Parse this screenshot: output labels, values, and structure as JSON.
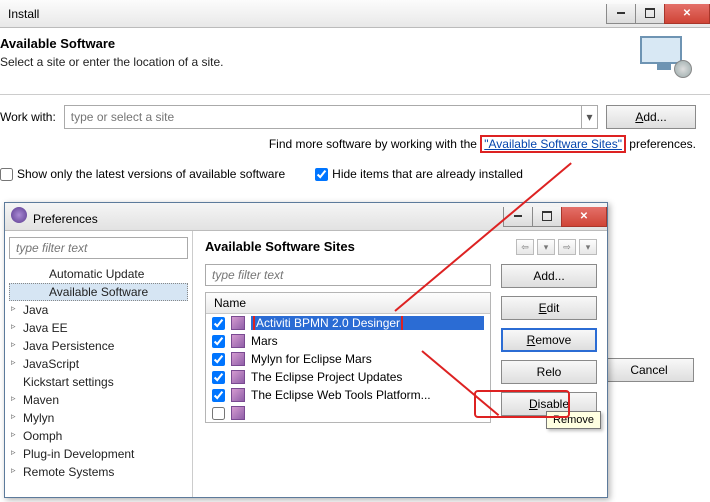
{
  "install": {
    "title": "Install",
    "header_title": "Available Software",
    "header_sub": "Select a site or enter the location of a site.",
    "work_with_label": "Work with:",
    "work_with_placeholder": "type or select a site",
    "add_button": "Add...",
    "helper_prefix": "Find more software by working with the ",
    "helper_link": "\"Available Software Sites\"",
    "helper_suffix": " preferences.",
    "check_latest": "Show only the latest versions of available software",
    "check_hide": "Hide items that are already installed",
    "cancel_button": "Cancel"
  },
  "pref": {
    "title": "Preferences",
    "filter_placeholder": "type filter text",
    "tree": {
      "automatic_update": "Automatic Update",
      "available_software": "Available Software",
      "java": "Java",
      "java_ee": "Java EE",
      "java_persistence": "Java Persistence",
      "javascript": "JavaScript",
      "kickstart": "Kickstart settings",
      "maven": "Maven",
      "mylyn": "Mylyn",
      "oomph": "Oomph",
      "plugin_dev": "Plug-in Development",
      "remote_systems": "Remote Systems"
    },
    "pane_title": "Available Software Sites",
    "filter2_placeholder": "type filter text",
    "col_name": "Name",
    "sites": [
      "Activiti BPMN 2.0 Desinger",
      "Mars",
      "Mylyn for Eclipse Mars",
      "The Eclipse Project Updates",
      "The Eclipse Web Tools Platform..."
    ],
    "buttons": {
      "add": "Add...",
      "edit": "Edit",
      "remove": "Remove",
      "reload": "Reload",
      "disable": "Disable"
    },
    "tooltip": "Remove"
  }
}
